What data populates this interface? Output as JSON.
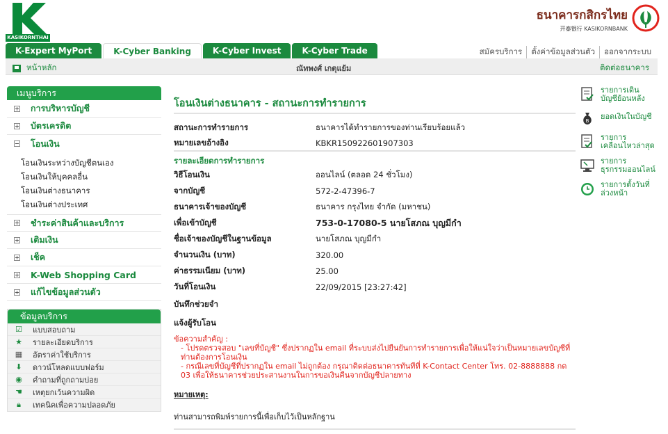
{
  "header": {
    "logo_text": "KASIKORNTHAI",
    "bank_name_th": "ธนาคารกสิกรไทย",
    "bank_name_en": "开泰银行 KASIKORNBANK",
    "tabs": [
      {
        "label": "K-Expert MyPort"
      },
      {
        "label": "K-Cyber Banking"
      },
      {
        "label": "K-Cyber Invest"
      },
      {
        "label": "K-Cyber Trade"
      }
    ],
    "top_links": [
      "สมัครบริการ",
      "ตั้งค่าข้อมูลส่วนตัว",
      "ออกจากระบบ"
    ]
  },
  "subbar": {
    "home": "หน้าหลัก",
    "user": "ณัทพงศ์ เกตุแย้ม",
    "contact": "ติดต่อธนาคาร"
  },
  "menu": {
    "title": "เมนูบริการ",
    "items_top": [
      {
        "label": "การบริหารบัญชี"
      },
      {
        "label": "บัตรเครดิต"
      },
      {
        "label": "โอนเงิน"
      }
    ],
    "transfer_sub": [
      "โอนเงินระหว่างบัญชีตนเอง",
      "โอนเงินให้บุคคลอื่น",
      "โอนเงินต่างธนาคาร",
      "โอนเงินต่างประเทศ"
    ],
    "items_bottom": [
      {
        "label": "ชำระค่าสินค้าและบริการ"
      },
      {
        "label": "เติมเงิน"
      },
      {
        "label": "เช็ค"
      },
      {
        "label": "K-Web Shopping Card"
      },
      {
        "label": "แก้ไขข้อมูลส่วนตัว"
      }
    ]
  },
  "service_info": {
    "title": "ข้อมูลบริการ",
    "items": [
      {
        "label": "แบบสอบถาม",
        "icon": "checkbox-icon"
      },
      {
        "label": "รายละเอียดบริการ",
        "icon": "star-icon"
      },
      {
        "label": "อัตราค่าใช้บริการ",
        "icon": "calculator-icon"
      },
      {
        "label": "ดาวน์โหลดแบบฟอร์ม",
        "icon": "download-icon"
      },
      {
        "label": "คำถามที่ถูกถามบ่อย",
        "icon": "faq-icon"
      },
      {
        "label": "เหตุยกเว้นความผิด",
        "icon": "hand-icon"
      },
      {
        "label": "เทคนิคเพื่อความปลอดภัย",
        "icon": "lock-icon"
      }
    ]
  },
  "main": {
    "title": "โอนเงินต่างธนาคาร - สถานะการทำรายการ",
    "status_label": "สถานะการทำรายการ",
    "status_value": "ธนาคารได้ทำรายการของท่านเรียบร้อยแล้ว",
    "ref_label": "หมายเลขอ้างอิง",
    "ref_value": "KBKR150922601907303",
    "details_title": "รายละเอียดการทำรายการ",
    "details": [
      {
        "label": "วิธีโอนเงิน",
        "value": "ออนไลน์ (ตลอด 24 ชั่วโมง)"
      },
      {
        "label": "จากบัญชี",
        "value": "572-2-47396-7"
      },
      {
        "label": "ธนาคารเจ้าของบัญชี",
        "value": "ธนาคาร กรุงไทย จำกัด (มหาชน)"
      },
      {
        "label": "เพื่อเข้าบัญชี",
        "value": "753-0-17080-5 นายโสภณ บุญมีกำ"
      },
      {
        "label": "ชื่อเจ้าของบัญชีในฐานข้อมูล",
        "value": "นายโสภณ บุญมีกำ"
      },
      {
        "label": "จำนวนเงิน (บาท)",
        "value": "320.00"
      },
      {
        "label": "ค่าธรรมเนียม (บาท)",
        "value": "25.00"
      },
      {
        "label": "วันที่โอนเงิน",
        "value": "22/09/2015 [23:27:42]"
      },
      {
        "label": "บันทึกช่วยจำ",
        "value": ""
      },
      {
        "label": "แจ้งผู้รับโอน",
        "value": ""
      }
    ],
    "notice_title": "ข้อความสำคัญ :",
    "notice_1": "- โปรดตรวจสอบ \"เลขที่บัญชี\" ซึ่งปรากฏใน email ที่ระบบส่งไปยืนยันการทำรายการเพื่อให้แน่ใจว่าเป็นหมายเลขบัญชีที่ท่านต้องการโอนเงิน",
    "notice_2": "- กรณีเลขที่บัญชีที่ปรากฏใน email ไม่ถูกต้อง กรุณาติดต่อธนาคารทันทีที่ K-Contact Center โทร. 02-8888888 กด 03 เพื่อให้ธนาคารช่วยประสานงานในการขอเงินคืนจากบัญชีปลายทาง",
    "note_title": "หมายเหตุ:",
    "note_text": "ท่านสามารถพิมพ์รายการนี้เพื่อเก็บไว้เป็นหลักฐาน"
  },
  "right_panel": {
    "items": [
      {
        "label": "รายการเดิน\nบัญชีย้อนหลัง",
        "icon": "statement-icon"
      },
      {
        "label": "ยอดเงินในบัญชี",
        "icon": "money-bag-icon"
      },
      {
        "label": "รายการ\nเคลื่อนไหวล่าสุด",
        "icon": "recent-transactions-icon"
      },
      {
        "label": "รายการ\nธุรกรรมออนไลน์",
        "icon": "online-transactions-icon"
      },
      {
        "label": "รายการตั้งวันที่\nล่วงหน้า",
        "icon": "clock-icon"
      }
    ]
  },
  "colors": {
    "brand_green": "#1b8a3e",
    "sidebar_header_green": "#22a04a",
    "alert_red": "#e1231c",
    "bank_name_brown": "#7a2a1a"
  }
}
